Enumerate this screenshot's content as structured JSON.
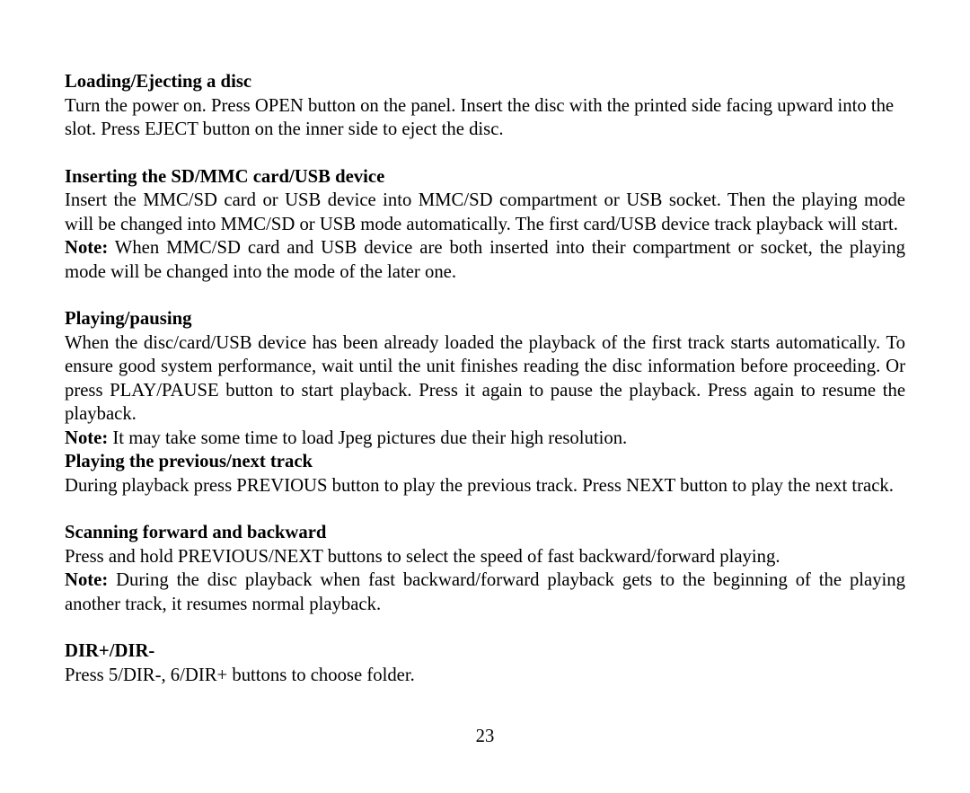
{
  "page_number": "23",
  "note_label": "Note:",
  "sections": {
    "loading": {
      "heading": "Loading/Ejecting a disc",
      "body": "Turn the power on. Press OPEN button on the panel. Insert the disc with the printed side facing upward into the slot. Press EJECT button on the inner side to eject the disc."
    },
    "inserting": {
      "heading": "Inserting the SD/MMC card/USB device",
      "body": "Insert the MMC/SD card or USB device into MMC/SD compartment or USB socket. Then the playing mode will be changed into MMC/SD or USB mode automatically. The first card/USB device track playback will start.",
      "note": " When MMC/SD card and USB device are both inserted into their compartment or socket, the playing mode will be changed into the mode of the later one."
    },
    "playing": {
      "heading": "Playing/pausing",
      "body": "When the disc/card/USB device has been already loaded the playback of the first track starts automatically. To ensure good system performance, wait until the unit finishes reading the disc information before proceeding. Or press PLAY/PAUSE button to start playback. Press it again to pause the playback. Press again to resume the playback.",
      "note": " It may take some time to load Jpeg pictures due their high resolution."
    },
    "prevnext": {
      "heading": "Playing the previous/next track",
      "body": "During playback press PREVIOUS button to play the previous track. Press NEXT button to play the next track."
    },
    "scanning": {
      "heading": "Scanning forward and backward",
      "body": "Press and hold PREVIOUS/NEXT buttons to select the speed of fast backward/forward playing.",
      "note": " During the disc playback when fast backward/forward playback gets to the beginning of the playing another track, it resumes normal playback."
    },
    "dir": {
      "heading": "DIR+/DIR-",
      "body": "Press 5/DIR-, 6/DIR+ buttons to choose folder."
    }
  }
}
